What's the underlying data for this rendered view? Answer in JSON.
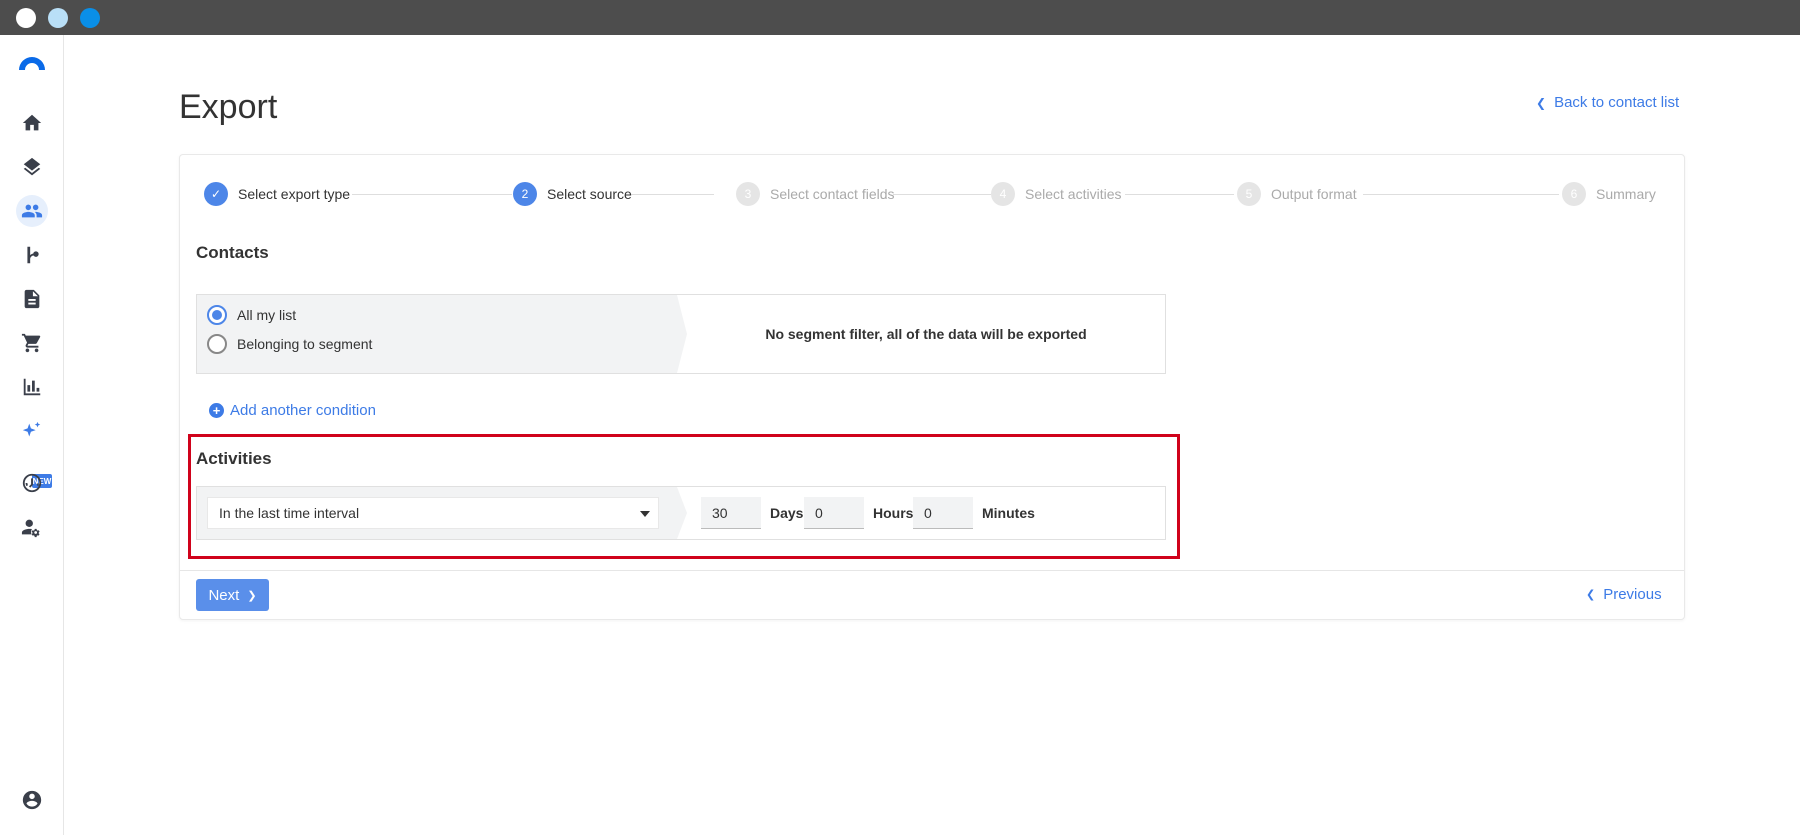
{
  "window": {
    "colors": {
      "titlebar": "#4d4d4d",
      "accent": "#3d7be6",
      "highlight": "#d0021b"
    }
  },
  "sidebar": {
    "items": [
      {
        "icon": "home-icon"
      },
      {
        "icon": "layers-icon"
      },
      {
        "icon": "contacts-icon",
        "active": true
      },
      {
        "icon": "automation-icon"
      },
      {
        "icon": "document-icon"
      },
      {
        "icon": "cart-icon"
      },
      {
        "icon": "chart-icon"
      },
      {
        "icon": "sparkle-icon",
        "badge": "NEW"
      },
      {
        "icon": "dashboard-icon"
      },
      {
        "icon": "user-settings-icon"
      }
    ],
    "profile_icon": "account-icon"
  },
  "header": {
    "title": "Export",
    "back_link": "Back to contact list"
  },
  "stepper": {
    "steps": [
      {
        "number": "✓",
        "label": "Select export type",
        "state": "done"
      },
      {
        "number": "2",
        "label": "Select source",
        "state": "current"
      },
      {
        "number": "3",
        "label": "Select contact fields",
        "state": "upcoming"
      },
      {
        "number": "4",
        "label": "Select activities",
        "state": "upcoming"
      },
      {
        "number": "5",
        "label": "Output format",
        "state": "upcoming"
      },
      {
        "number": "6",
        "label": "Summary",
        "state": "upcoming"
      }
    ]
  },
  "contacts": {
    "title": "Contacts",
    "options": [
      {
        "label": "All my list",
        "checked": true
      },
      {
        "label": "Belonging to segment",
        "checked": false
      }
    ],
    "note": "No segment filter, all of the data will be exported",
    "add_condition": "Add another condition"
  },
  "activities": {
    "title": "Activities",
    "interval_select": "In the last time interval",
    "days_value": "30",
    "days_label": "Days",
    "hours_value": "0",
    "hours_label": "Hours",
    "minutes_value": "0",
    "minutes_label": "Minutes"
  },
  "footer": {
    "next_label": "Next",
    "previous_label": "Previous"
  }
}
